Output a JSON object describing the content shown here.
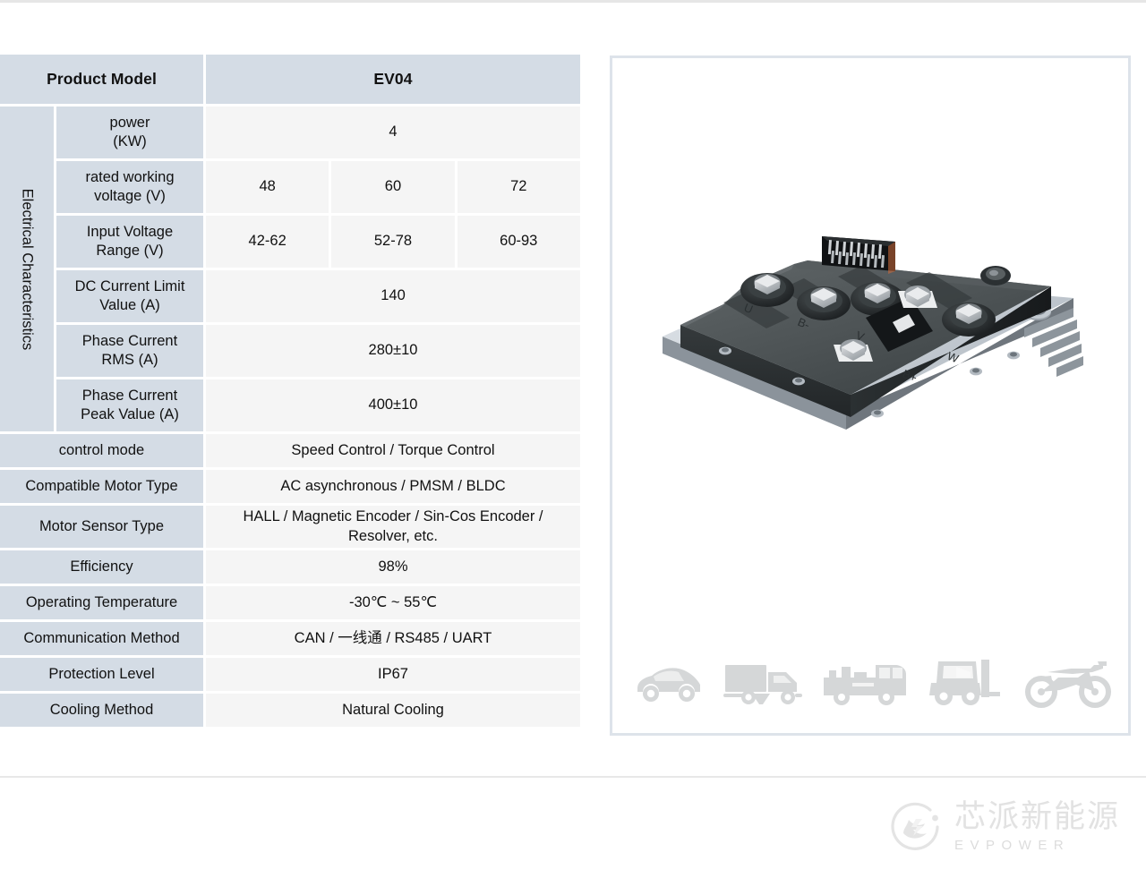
{
  "table": {
    "header": {
      "label": "Product Model",
      "value": "EV04"
    },
    "group_label": "Electrical Characteristics",
    "electrical_rows": [
      {
        "label": "power\n(KW)",
        "label_l1": "power",
        "label_l2": "(KW)",
        "value": "4",
        "split": false
      },
      {
        "label_l1": "rated working",
        "label_l2": "voltage (V)",
        "split": true,
        "values": [
          "48",
          "60",
          "72"
        ]
      },
      {
        "label_l1": "Input Voltage",
        "label_l2": "Range (V)",
        "split": true,
        "values": [
          "42-62",
          "52-78",
          "60-93"
        ]
      },
      {
        "label_l1": "DC Current Limit",
        "label_l2": "Value (A)",
        "split": false,
        "value": "140"
      },
      {
        "label_l1": "Phase Current",
        "label_l2": "RMS (A)",
        "split": false,
        "value": "280±10"
      },
      {
        "label_l1": "Phase Current",
        "label_l2": "Peak Value (A)",
        "split": false,
        "value": "400±10"
      }
    ],
    "general_rows": [
      {
        "label": "control mode",
        "value": "Speed Control / Torque Control"
      },
      {
        "label": "Compatible Motor Type",
        "value": "AC asynchronous  /  PMSM / BLDC"
      },
      {
        "label": "Motor Sensor Type",
        "value_l1": "HALL / Magnetic Encoder / Sin-Cos Encoder /",
        "value_l2": "Resolver, etc.",
        "two_line": true
      },
      {
        "label": "Efficiency",
        "value": "98%"
      },
      {
        "label": "Operating Temperature",
        "value": "-30℃ ~ 55℃"
      },
      {
        "label": "Communication Method",
        "value": "CAN / 一线通 / RS485 / UART"
      },
      {
        "label": "Protection Level",
        "value": "IP67"
      },
      {
        "label": "Cooling Method",
        "value": "Natural Cooling"
      }
    ]
  },
  "image_panel": {
    "product_alt": "EV04 motor controller 3D render",
    "terminal_labels": [
      "U",
      "B-",
      "V",
      "B+",
      "W"
    ],
    "vehicle_icons": [
      "car-icon",
      "truck-icon",
      "utility-vehicle-icon",
      "forklift-icon",
      "motorcycle-icon"
    ]
  },
  "brand": {
    "chinese": "芯派新能源",
    "english": "EVPOWER",
    "mark": "leaf-swirl-logo-icon"
  },
  "colors": {
    "header_bg": "#d4dce5",
    "value_bg": "#f5f5f5",
    "panel_border": "#dde3ea",
    "icon_gray": "#d5d7d8",
    "brand_gray": "#e2e2e2"
  }
}
